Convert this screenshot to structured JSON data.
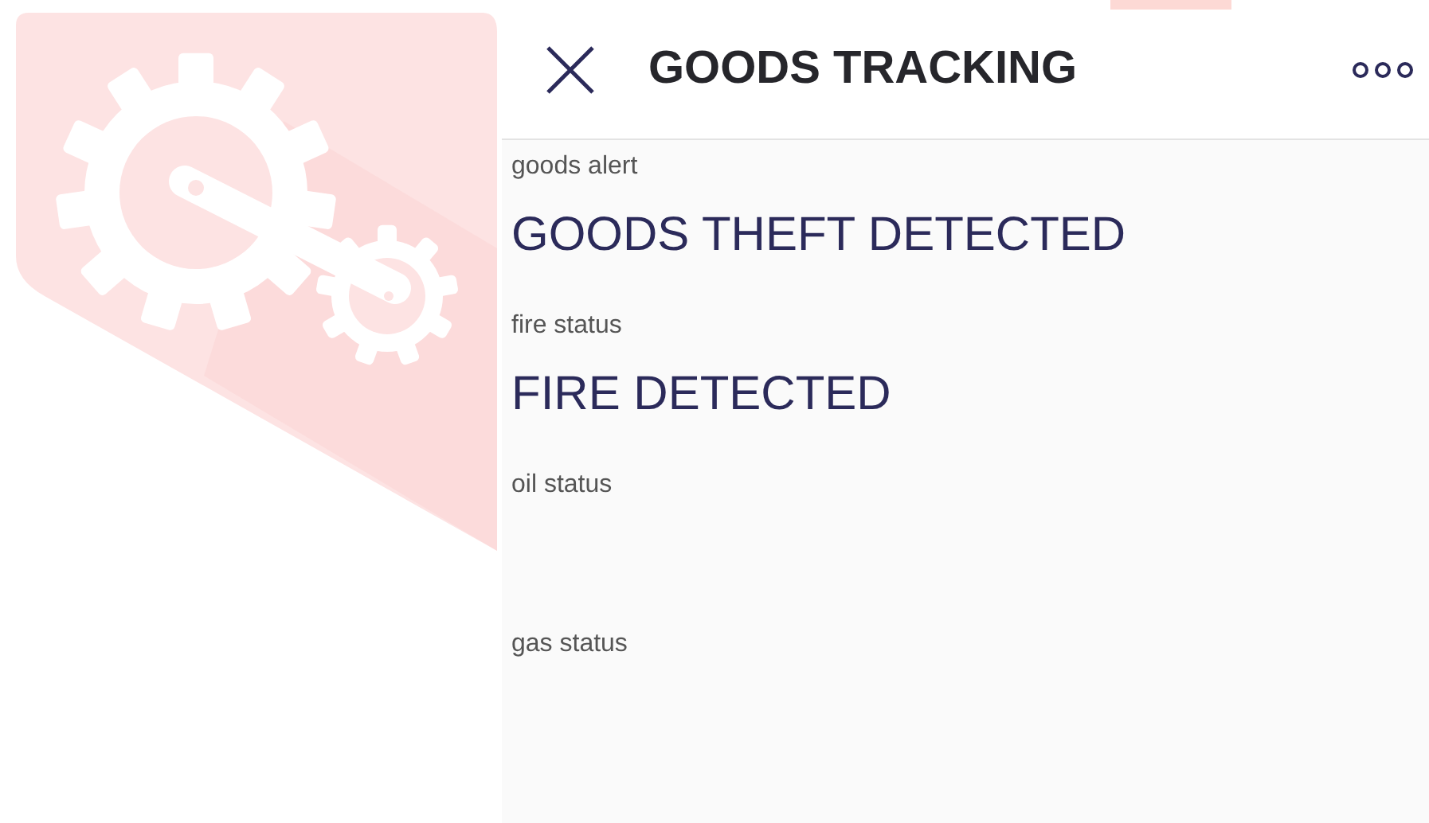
{
  "header": {
    "title": "GOODS TRACKING"
  },
  "fields": [
    {
      "label": "goods alert",
      "value": "GOODS THEFT DETECTED"
    },
    {
      "label": "fire status",
      "value": "FIRE DETECTED"
    },
    {
      "label": "oil status"
    },
    {
      "label": "gas status"
    }
  ]
}
